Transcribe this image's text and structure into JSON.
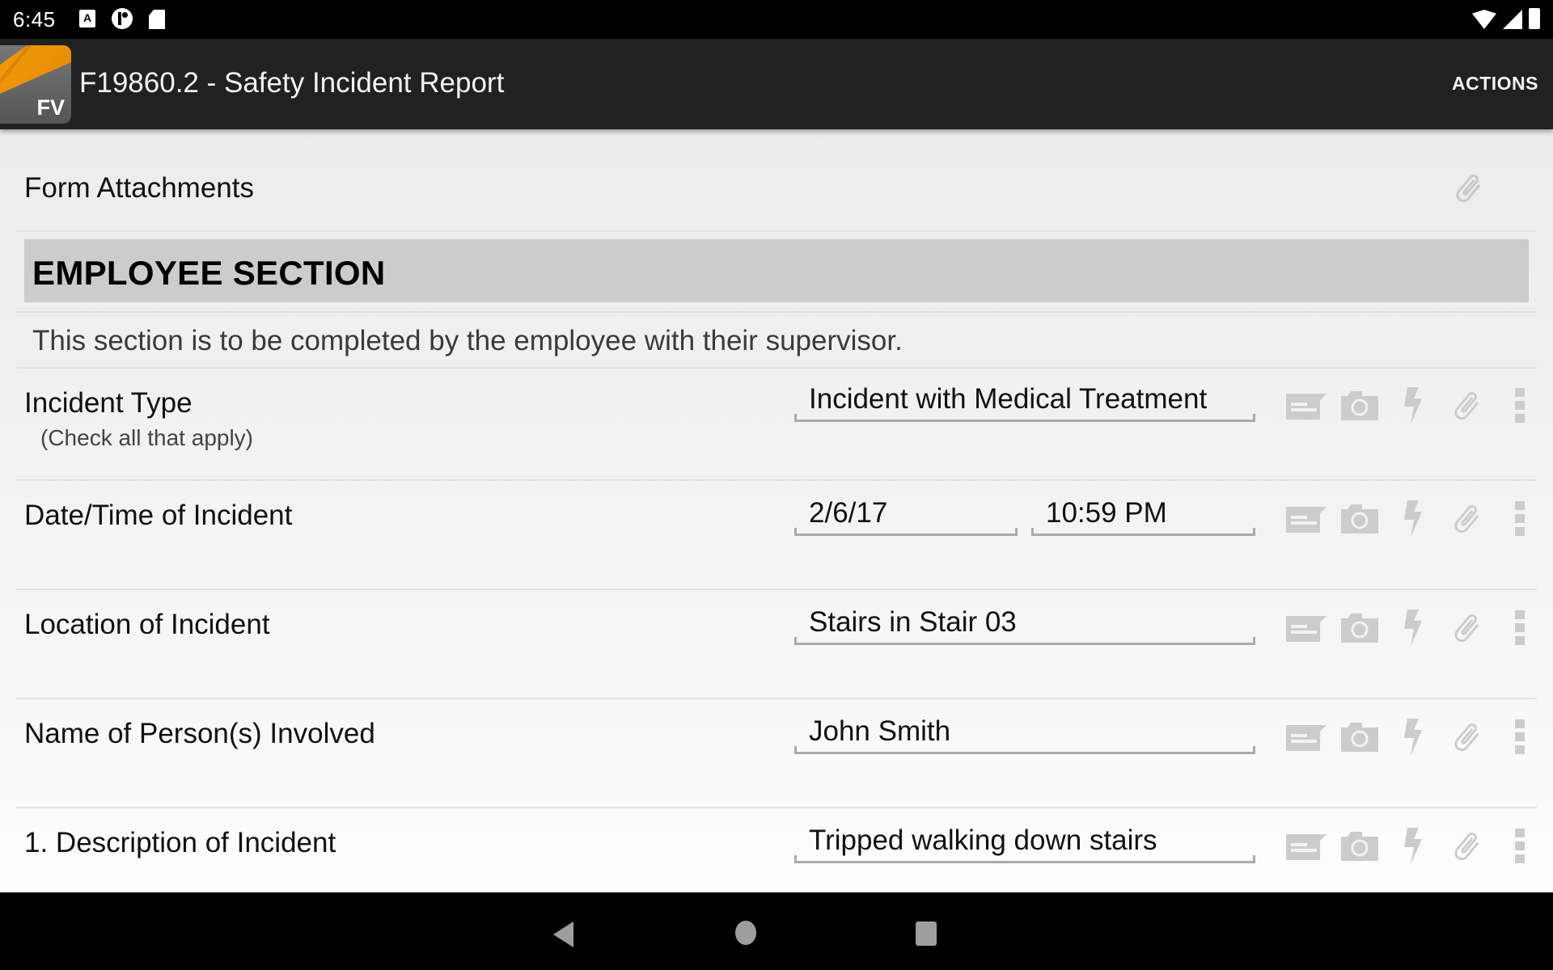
{
  "status_bar": {
    "time": "6:45",
    "left_icons": [
      "a-notification-icon",
      "p-notification-icon",
      "sd-card-icon"
    ],
    "right_icons": [
      "wifi-icon",
      "signal-icon",
      "battery-icon"
    ],
    "a_glyph": "A"
  },
  "app_bar": {
    "logo_text": "FV",
    "title": "F19860.2 - Safety Incident Report",
    "actions_label": "ACTIONS"
  },
  "form": {
    "attachments_label": "Form Attachments",
    "section_title": "EMPLOYEE SECTION",
    "section_instruction": "This section is to be completed by the employee with their supervisor.",
    "fields": [
      {
        "label": "Incident Type",
        "sublabel": "(Check all that apply)",
        "value": "Incident with Medical Treatment"
      },
      {
        "label": "Date/Time of Incident",
        "date_value": "2/6/17",
        "time_value": "10:59 PM"
      },
      {
        "label": "Location of Incident",
        "value": "Stairs in Stair 03"
      },
      {
        "label": "Name of Person(s) Involved",
        "value": "John Smith"
      },
      {
        "label": "1. Description of Incident",
        "value": "Tripped walking down stairs"
      }
    ],
    "row_tools": [
      "note-icon",
      "camera-icon",
      "lightning-icon",
      "paperclip-icon",
      "more-vert-icon"
    ]
  },
  "colors": {
    "app_bar": "#212121",
    "section_header": "#cccccc",
    "tool_icon": "#cccccc",
    "logo_orange": "#f59a0a"
  },
  "nav_bar": {
    "buttons": [
      "back",
      "home",
      "recents"
    ]
  }
}
